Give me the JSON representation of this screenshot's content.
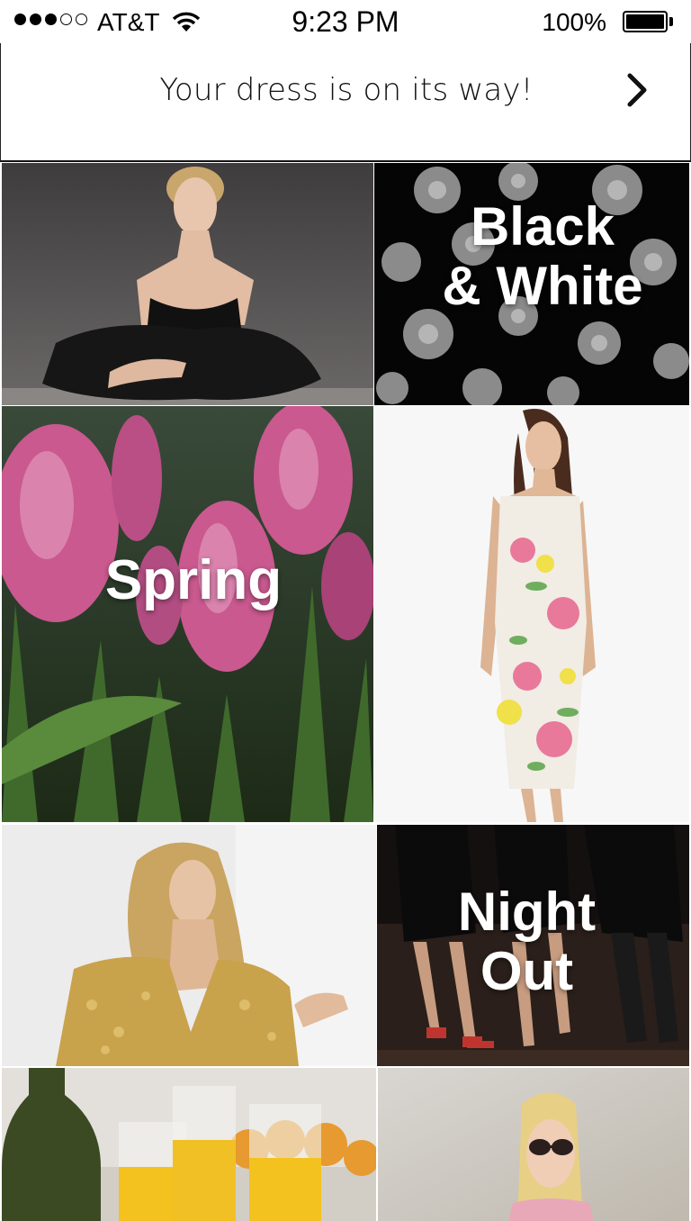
{
  "status_bar": {
    "carrier": "AT&T",
    "time": "9:23 PM",
    "battery": "100%",
    "signal_bars_filled": 3,
    "signal_bars_total": 5
  },
  "notice": {
    "text": "Your dress is on its way!",
    "arrow_icon": "chevron-right-icon"
  },
  "tiles": [
    {
      "name": "black-tulle-dress-photo",
      "label": ""
    },
    {
      "name": "black-and-white-category",
      "label_line1": "Black",
      "label_line2": "& White"
    },
    {
      "name": "spring-category",
      "label": "Spring"
    },
    {
      "name": "floral-dress-photo",
      "label": ""
    },
    {
      "name": "gold-sequin-photo",
      "label": ""
    },
    {
      "name": "night-out-category",
      "label_line1": "Night",
      "label_line2": "Out"
    },
    {
      "name": "brunch-drinks-photo",
      "label": ""
    },
    {
      "name": "blonde-sunglasses-photo",
      "label": ""
    }
  ],
  "colors": {
    "tulip_pink": "#c9598f",
    "leaf_green": "#3f6a2c",
    "flower_gray": "#9a9a9a",
    "gold": "#c9a24c",
    "juice": "#f3c21e"
  }
}
